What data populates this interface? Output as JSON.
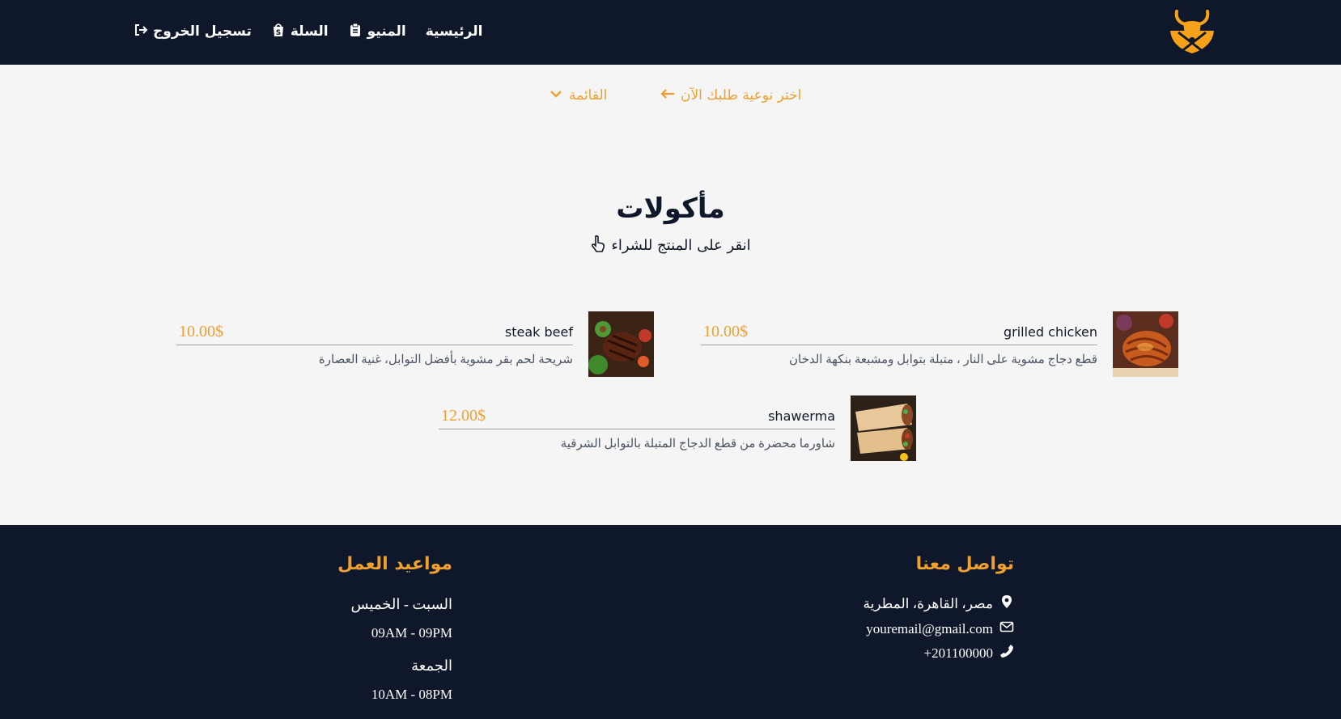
{
  "nav": {
    "logo_icon": "bull-knives-logo-icon",
    "links": [
      {
        "label": "الرئيسية",
        "icon": ""
      },
      {
        "label": "المنيو",
        "icon": "clipboard-icon"
      },
      {
        "label": "السلة",
        "icon": "shopping-bag-icon"
      },
      {
        "label": "تسجيل الخروج",
        "icon": "logout-icon"
      }
    ]
  },
  "subnav": {
    "choose_label": "اختر نوعية طلبك الآن",
    "menu_label": "القائمة"
  },
  "main": {
    "title": "مأكولات",
    "subtitle": "انقر على المنتج للشراء"
  },
  "items": [
    {
      "name": "grilled chicken",
      "price": "10.00$",
      "description": "قطع دجاج مشوية على النار ، متبلة بتوابل ومشبعة بنكهة الدخان"
    },
    {
      "name": "steak beef",
      "price": "10.00$",
      "description": "شريحة لحم بقر مشوية بأفضل التوابل، غنية العصارة"
    },
    {
      "name": "shawerma",
      "price": "12.00$",
      "description": "شاورما محضرة من قطع الدجاج المتبلة بالتوابل الشرقية"
    }
  ],
  "footer": {
    "contact_heading": "تواصل معنا",
    "address": "مصر، القاهرة، المطرية",
    "email": "youremail@gmail.com",
    "phone": "+201100000",
    "hours_heading": "مواعيد العمل",
    "days1": "السبت - الخميس",
    "time1": "09AM - 09PM",
    "days2": "الجمعة",
    "time2": "10AM - 08PM"
  },
  "colors": {
    "navy": "#0f172a",
    "accent": "#f0a030",
    "background": "#f5f5f5"
  }
}
